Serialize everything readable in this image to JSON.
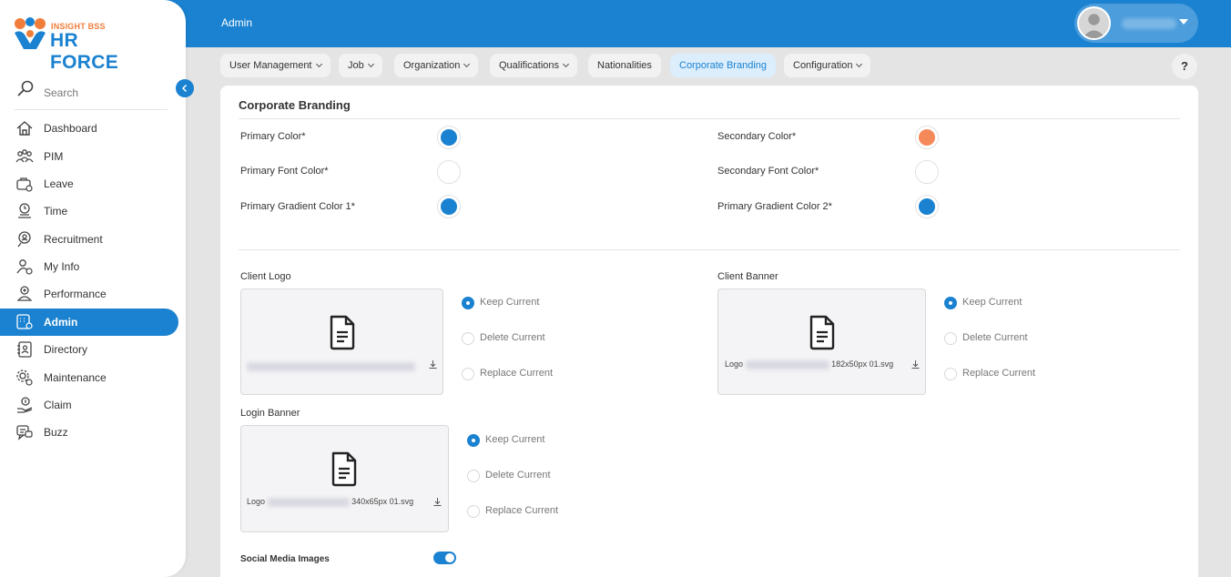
{
  "brand": {
    "top": "INSIGHT BSS",
    "name": "HR FORCE",
    "orange": "#f07d3a",
    "blue": "#1a82d0"
  },
  "header": {
    "breadcrumb": "Admin"
  },
  "sidebar": {
    "search_placeholder": "Search",
    "items": [
      {
        "label": "Dashboard",
        "icon": "home-icon"
      },
      {
        "label": "PIM",
        "icon": "people-icon"
      },
      {
        "label": "Leave",
        "icon": "leave-icon"
      },
      {
        "label": "Time",
        "icon": "time-icon"
      },
      {
        "label": "Recruitment",
        "icon": "recruitment-icon"
      },
      {
        "label": "My Info",
        "icon": "my-info-icon"
      },
      {
        "label": "Performance",
        "icon": "performance-icon"
      },
      {
        "label": "Admin",
        "icon": "admin-icon",
        "active": true
      },
      {
        "label": "Directory",
        "icon": "directory-icon"
      },
      {
        "label": "Maintenance",
        "icon": "maintenance-icon"
      },
      {
        "label": "Claim",
        "icon": "claim-icon"
      },
      {
        "label": "Buzz",
        "icon": "buzz-icon"
      }
    ]
  },
  "tabs": {
    "user_management": "User Management",
    "job": "Job",
    "organization": "Organization",
    "qualifications": "Qualifications",
    "nationalities": "Nationalities",
    "corporate_branding": "Corporate Branding",
    "configuration": "Configuration",
    "help": "?"
  },
  "branding": {
    "title": "Corporate Branding",
    "primary_color": {
      "label": "Primary Color*",
      "value": "#1a82d0"
    },
    "secondary_color": {
      "label": "Secondary Color*",
      "value": "#f5895a"
    },
    "primary_font_color": {
      "label": "Primary Font Color*",
      "value": "#ffffff"
    },
    "secondary_font_color": {
      "label": "Secondary Font Color*",
      "value": "#ffffff"
    },
    "primary_gradient_1": {
      "label": "Primary Gradient Color 1*",
      "value": "#1a82d0"
    },
    "primary_gradient_2": {
      "label": "Primary Gradient Color 2*",
      "value": "#1a82d0"
    }
  },
  "files": {
    "client_logo": {
      "label": "Client Logo",
      "prefix": "",
      "suffix": ""
    },
    "client_banner": {
      "label": "Client Banner",
      "prefix": "Logo",
      "suffix": "182x50px 01.svg"
    },
    "login_banner": {
      "label": "Login Banner",
      "prefix": "Logo",
      "suffix": "340x65px 01.svg"
    }
  },
  "radio": {
    "keep": "Keep Current",
    "delete": "Delete Current",
    "replace": "Replace Current"
  },
  "social_media": {
    "label": "Social Media Images",
    "enabled": true
  }
}
